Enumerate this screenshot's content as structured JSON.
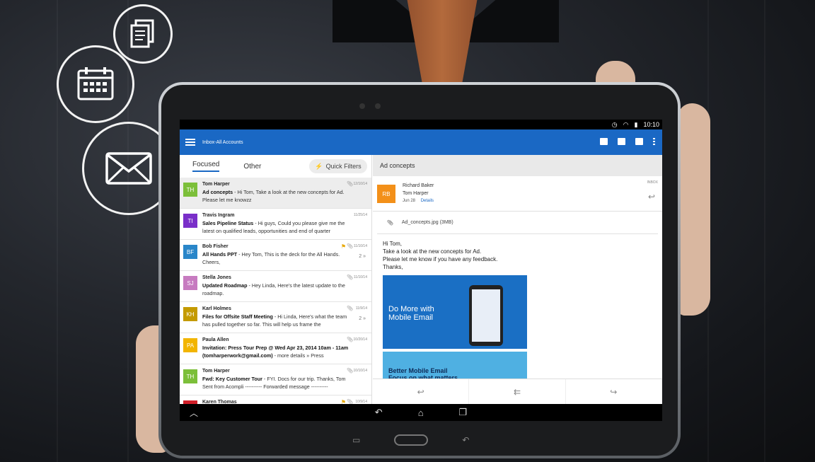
{
  "statusbar": {
    "time": "10:10"
  },
  "appbar": {
    "title": "Inbox-All Accounts"
  },
  "tabs": {
    "focused": "Focused",
    "other": "Other",
    "quick_filters": "Quick Filters"
  },
  "mails": [
    {
      "initials": "TH",
      "color": "#7cbf3a",
      "from": "Tom Harper",
      "subject": "Ad concepts",
      "preview": " - Hi Tom, Take a look at the new concepts for Ad. Please let me knowzz",
      "date": "12/10/14",
      "clip": true,
      "flag": false,
      "count": ""
    },
    {
      "initials": "TI",
      "color": "#7a2fc9",
      "from": "Travis Ingram",
      "subject": "Sales Pipeline Status",
      "preview": " - Hi guys, Could you please give me the latest on qualified leads, opportunities and end of quarter",
      "date": "11/25/14",
      "clip": false,
      "flag": false,
      "count": ""
    },
    {
      "initials": "BF",
      "color": "#2a86c9",
      "from": "Bob Fisher",
      "subject": "All Hands PPT",
      "preview": " - Hey Tom, This is the deck for the All Hands. Cheers,",
      "date": "11/10/14",
      "clip": true,
      "flag": true,
      "count": "2"
    },
    {
      "initials": "SJ",
      "color": "#c77bc0",
      "from": "Stella Jones",
      "subject": "Updated Roadmap",
      "preview": " - Hey Linda, Here's the latest update to the roadmap.",
      "date": "11/10/14",
      "clip": true,
      "flag": false,
      "count": ""
    },
    {
      "initials": "KH",
      "color": "#c49a00",
      "from": "Karl Holmes",
      "subject": "Files for Offsite Staff Meeting",
      "preview": " - Hi Linda, Here's what the team has pulled together so far. This will help us frame the",
      "date": "11/9/14",
      "clip": true,
      "flag": false,
      "count": "2"
    },
    {
      "initials": "PA",
      "color": "#f2b500",
      "from": "Paula Allen",
      "subject": "Invitation: Press Tour Prep @ Wed Apr 23, 2014 10am - 11am (tomharperwork@gmail.com)",
      "preview": " - more details » Press",
      "date": "10/20/14",
      "clip": true,
      "flag": false,
      "count": ""
    },
    {
      "initials": "TH",
      "color": "#7cbf3a",
      "from": "Tom Harper",
      "subject": "Fwd: Key Customer Tour",
      "preview": " - FYI. Docs for our trip. Thanks, Tom Sent from Acompli ---------- Forwarded message ----------",
      "date": "10/10/14",
      "clip": true,
      "flag": false,
      "count": ""
    },
    {
      "initials": "KT",
      "color": "#d0202a",
      "from": "Karen Thomas",
      "subject": "",
      "preview": "",
      "date": "10/9/14",
      "clip": true,
      "flag": true,
      "count": ""
    }
  ],
  "reading": {
    "subject": "Ad concepts",
    "sender_initials": "RB",
    "sender": "Richard Baker",
    "to": "Tom Harper",
    "date": "Jun 28",
    "details": "Details",
    "folder": "INBOX",
    "attachment": "Ad_concepts.jpg (3MB)",
    "greeting": "Hi Tom,",
    "line1": "Take a look at the new concepts for Ad.",
    "line2": "Please let me know if you have any feedback.",
    "closing": "Thanks,",
    "promo1": "Do More with Mobile Email",
    "promo2": "Better Mobile Email Focus on what matters"
  },
  "colors": {
    "accent": "#1a68c4",
    "sender_avatar": "#f39019"
  }
}
